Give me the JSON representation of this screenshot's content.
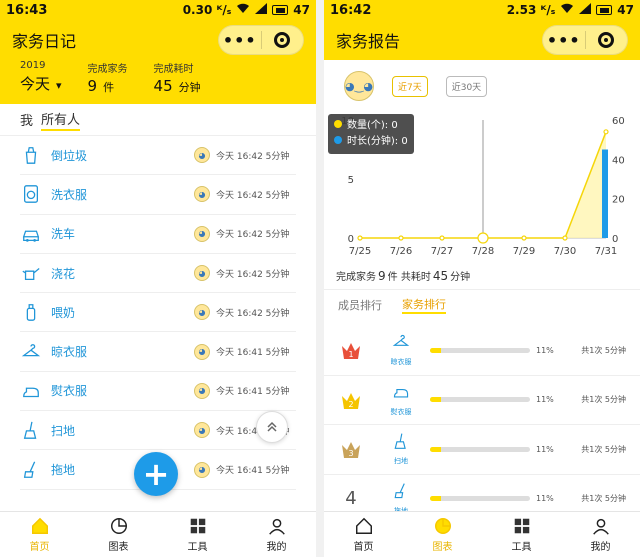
{
  "left": {
    "status": {
      "time": "16:43",
      "speed": "0.30 ᴷ/ₛ",
      "battery": "47"
    },
    "title": "家务日记",
    "summary": [
      {
        "label": "2019",
        "value": "今天",
        "unit": "▾"
      },
      {
        "label": "完成家务",
        "value": "9",
        "unit": "件"
      },
      {
        "label": "完成耗时",
        "value": "45",
        "unit": "分钟"
      }
    ],
    "filter": {
      "me": "我",
      "all": "所有人"
    },
    "chores": [
      {
        "name": "倒垃圾",
        "icon": "trash-bag-icon",
        "meta": "今天 16:42 5分钟"
      },
      {
        "name": "洗衣服",
        "icon": "washing-machine-icon",
        "meta": "今天 16:42 5分钟"
      },
      {
        "name": "洗车",
        "icon": "car-wash-icon",
        "meta": "今天 16:42 5分钟"
      },
      {
        "name": "浇花",
        "icon": "watering-can-icon",
        "meta": "今天 16:42 5分钟"
      },
      {
        "name": "喂奶",
        "icon": "baby-bottle-icon",
        "meta": "今天 16:42 5分钟"
      },
      {
        "name": "晾衣服",
        "icon": "clothes-hanger-icon",
        "meta": "今天 16:41 5分钟"
      },
      {
        "name": "熨衣服",
        "icon": "iron-icon",
        "meta": "今天 16:41 5分钟"
      },
      {
        "name": "扫地",
        "icon": "broom-icon",
        "meta": "今天 16:41 5分钟"
      },
      {
        "name": "拖地",
        "icon": "mop-icon",
        "meta": "今天 16:41 5分钟"
      }
    ],
    "tabs": [
      {
        "label": "首页",
        "icon": "home-icon"
      },
      {
        "label": "图表",
        "icon": "pie-chart-icon"
      },
      {
        "label": "工具",
        "icon": "tools-grid-icon"
      },
      {
        "label": "我的",
        "icon": "profile-icon"
      }
    ]
  },
  "right": {
    "status": {
      "time": "16:42",
      "speed": "2.53 ᴷ/ₛ",
      "battery": "47"
    },
    "title": "家务报告",
    "ranges": [
      "近7天",
      "近30天"
    ],
    "tooltip": {
      "count_label": "数量(个): 0",
      "duration_label": "时长(分钟): 0"
    },
    "summary": {
      "prefix": "完成家务",
      "count": "9",
      "mid": "件 共耗时",
      "minutes": "45",
      "suffix": "分钟"
    },
    "rank_tabs": [
      "成员排行",
      "家务排行"
    ],
    "ranking": [
      {
        "rank": "1",
        "name": "晾衣服",
        "icon": "clothes-hanger-icon",
        "percent": "11%",
        "fill": 0.11,
        "count": "共1次 5分钟"
      },
      {
        "rank": "2",
        "name": "熨衣服",
        "icon": "iron-icon",
        "percent": "11%",
        "fill": 0.11,
        "count": "共1次 5分钟"
      },
      {
        "rank": "3",
        "name": "扫地",
        "icon": "broom-icon",
        "percent": "11%",
        "fill": 0.11,
        "count": "共1次 5分钟"
      },
      {
        "rank": "4",
        "name": "拖地",
        "icon": "mop-icon",
        "percent": "11%",
        "fill": 0.11,
        "count": "共1次 5分钟"
      }
    ]
  },
  "chart_data": {
    "type": "line",
    "categories": [
      "7/25",
      "7/26",
      "7/27",
      "7/28",
      "7/29",
      "7/30",
      "7/31"
    ],
    "series": [
      {
        "name": "数量(个)",
        "values": [
          0,
          0,
          0,
          0,
          0,
          0,
          9
        ],
        "axis": "left",
        "color": "#f5d60a"
      },
      {
        "name": "时长(分钟)",
        "values": [
          0,
          0,
          0,
          0,
          0,
          0,
          45
        ],
        "axis": "right",
        "color": "#1e9be8"
      }
    ],
    "y_left": {
      "ticks": [
        0,
        5,
        10
      ],
      "lim": [
        0,
        10
      ]
    },
    "y_right": {
      "ticks": [
        0,
        20,
        40,
        60
      ],
      "lim": [
        0,
        60
      ]
    }
  },
  "colors": {
    "brand": "#ffdd00",
    "accent_blue": "#1e9be8",
    "active_tab": "#e8b400"
  }
}
